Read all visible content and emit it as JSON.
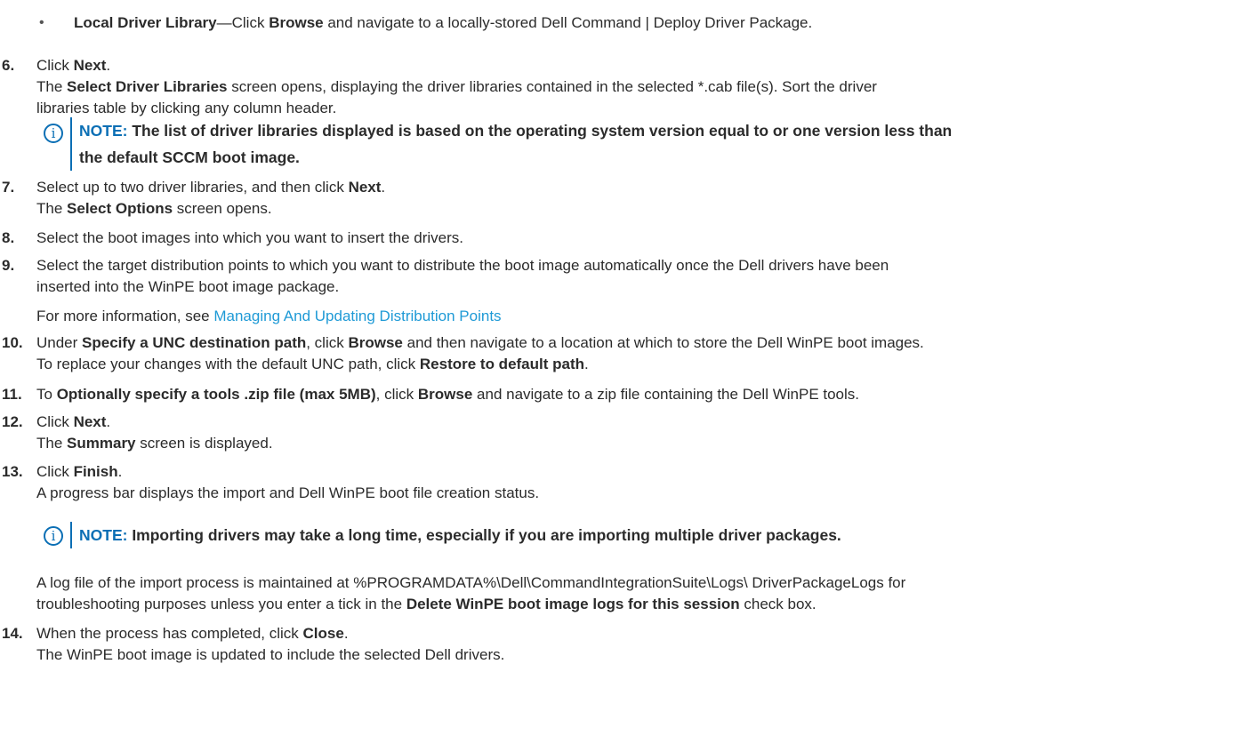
{
  "bullet": {
    "glyph": "•",
    "term": "Local Driver Library",
    "text1": "—Click ",
    "bold1": "Browse",
    "text2": " and navigate to a locally-stored Dell Command | Deploy Driver Package."
  },
  "steps": {
    "s6": {
      "num": "6.",
      "l1a": "Click ",
      "l1b": "Next",
      "l1c": ".",
      "l2a": "The ",
      "l2b": "Select Driver Libraries",
      "l2c": " screen opens, displaying the driver libraries contained in the selected *.cab file(s). Sort the driver",
      "l3": "libraries table by clicking any column header."
    },
    "note1": {
      "label": "NOTE:",
      "l1": " The list of driver libraries displayed is based on the operating system version equal to or one version less than",
      "l2": "the default SCCM boot image."
    },
    "s7": {
      "num": "7.",
      "l1a": "Select up to two driver libraries, and then click ",
      "l1b": "Next",
      "l1c": ".",
      "l2a": "The ",
      "l2b": "Select Options",
      "l2c": " screen opens."
    },
    "s8": {
      "num": "8.",
      "l1": "Select the boot images into which you want to insert the drivers."
    },
    "s9": {
      "num": "9.",
      "l1": "Select the target distribution points to which you want to distribute the boot image automatically once the Dell drivers have been",
      "l2": "inserted into the WinPE boot image package.",
      "l3a": "For more information, see ",
      "l3link": "Managing And Updating Distribution Points"
    },
    "s10": {
      "num": "10.",
      "l1a": "Under ",
      "l1b": "Specify a UNC destination path",
      "l1c": ", click ",
      "l1d": "Browse",
      "l1e": " and then navigate to a location at which to store the Dell WinPE boot images.",
      "l2a": "To replace your changes with the default UNC path, click ",
      "l2b": "Restore to default path",
      "l2c": "."
    },
    "s11": {
      "num": "11.",
      "l1a": "To ",
      "l1b": "Optionally specify a tools .zip file (max 5MB)",
      "l1c": ", click ",
      "l1d": "Browse",
      "l1e": " and navigate to a zip file containing the Dell WinPE tools."
    },
    "s12": {
      "num": "12.",
      "l1a": "Click ",
      "l1b": "Next",
      "l1c": ".",
      "l2a": "The ",
      "l2b": "Summary",
      "l2c": " screen is displayed."
    },
    "s13": {
      "num": "13.",
      "l1a": "Click ",
      "l1b": "Finish",
      "l1c": ".",
      "l2": "A progress bar displays the import and Dell WinPE boot file creation status."
    },
    "note2": {
      "label": "NOTE:",
      "l1": " Importing drivers may take a long time, especially if you are importing multiple driver packages."
    },
    "log": {
      "l1": "A log file of the import process is maintained at %PROGRAMDATA%\\Dell\\CommandIntegrationSuite\\Logs\\ DriverPackageLogs for",
      "l2a": "troubleshooting purposes unless you enter a tick in the ",
      "l2b": "Delete WinPE boot image logs for this session",
      "l2c": " check box."
    },
    "s14": {
      "num": "14.",
      "l1a": "When the process has completed, click ",
      "l1b": "Close",
      "l1c": ".",
      "l2": "The WinPE boot image is updated to include the selected Dell drivers."
    }
  },
  "note_icon_glyph": "i",
  "colors": {
    "accent": "#0b6fb5",
    "link": "#1f9ad6",
    "text": "#2b2b2b"
  }
}
